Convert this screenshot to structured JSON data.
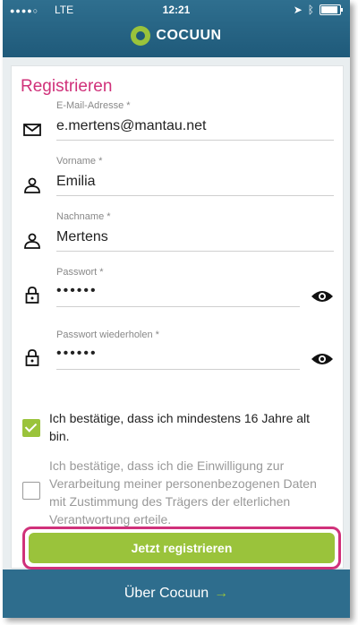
{
  "status_bar": {
    "carrier": "LTE",
    "time": "12:21"
  },
  "brand": {
    "name": "COCUUN"
  },
  "form": {
    "title": "Registrieren",
    "email": {
      "label": "E-Mail-Adresse *",
      "value": "e.mertens@mantau.net"
    },
    "firstname": {
      "label": "Vorname *",
      "value": "Emilia"
    },
    "lastname": {
      "label": "Nachname *",
      "value": "Mertens"
    },
    "password": {
      "label": "Passwort *",
      "value": "••••••"
    },
    "password_repeat": {
      "label": "Passwort wiederholen *",
      "value": "••••••"
    },
    "consent_age": {
      "text": "Ich bestätige, dass ich mindestens 16 Jahre alt bin.",
      "checked": true
    },
    "consent_data": {
      "text": "Ich bestätige, dass ich die Einwilligung zur Verarbeitung meiner personenbezogenen Daten mit Zustimmung des Trägers der elterlichen Verantwortung erteile.",
      "checked": false
    },
    "submit_label": "Jetzt registrieren"
  },
  "footer": {
    "label": "Über Cocuun",
    "arrow": "→"
  },
  "colors": {
    "header": "#1f5a7a",
    "accent_green": "#9ac33b",
    "title_pink": "#d0317a"
  }
}
